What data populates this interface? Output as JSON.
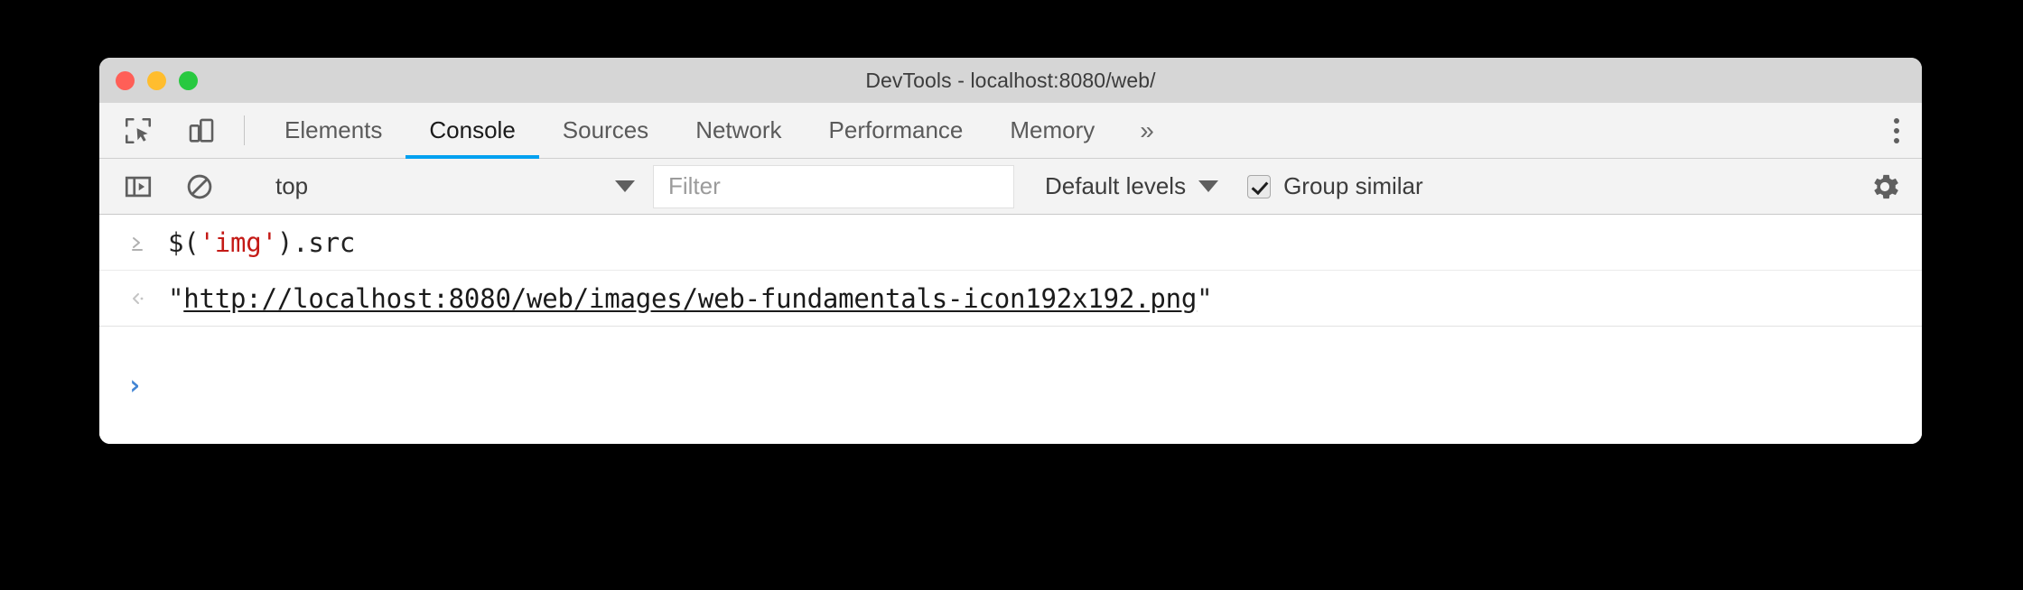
{
  "window": {
    "title": "DevTools - localhost:8080/web/",
    "traffic_lights": [
      {
        "name": "close",
        "color": "#ff5f57"
      },
      {
        "name": "minimize",
        "color": "#ffbd2e"
      },
      {
        "name": "zoom",
        "color": "#28c940"
      }
    ]
  },
  "theme": {
    "accent": "#00a0f0",
    "string_color": "#c41a16",
    "prompt_color": "#4285d4",
    "titlebar_bg": "#d6d6d6",
    "toolbar_bg": "#f3f3f3"
  },
  "toolbar_icons": {
    "inspect": "inspect-element-icon",
    "device": "device-toolbar-icon"
  },
  "tabs": [
    {
      "label": "Elements",
      "active": false
    },
    {
      "label": "Console",
      "active": true
    },
    {
      "label": "Sources",
      "active": false
    },
    {
      "label": "Network",
      "active": false
    },
    {
      "label": "Performance",
      "active": false
    },
    {
      "label": "Memory",
      "active": false
    }
  ],
  "tab_overflow_label": "»",
  "console_toolbar": {
    "sidebar_toggle": "console-sidebar-icon",
    "clear_console": "clear-console-icon",
    "context": "top",
    "filter_placeholder": "Filter",
    "filter_value": "",
    "levels_label": "Default levels",
    "group_similar_label": "Group similar",
    "group_similar_checked": true,
    "settings": "settings-gear-icon"
  },
  "console": {
    "messages": [
      {
        "type": "input",
        "gutter": "⌫",
        "parts": [
          {
            "text": "$(",
            "style": "plain"
          },
          {
            "text": "'img'",
            "style": "string"
          },
          {
            "text": ").src",
            "style": "plain"
          }
        ]
      },
      {
        "type": "result",
        "gutter": "‹",
        "parts": [
          {
            "text": "\"",
            "style": "plain"
          },
          {
            "text": "http://localhost:8080/web/images/web-fundamentals-icon192x192.png",
            "style": "link"
          },
          {
            "text": "\"",
            "style": "plain"
          }
        ]
      }
    ],
    "prompt_symbol": "›",
    "prompt_value": ""
  }
}
